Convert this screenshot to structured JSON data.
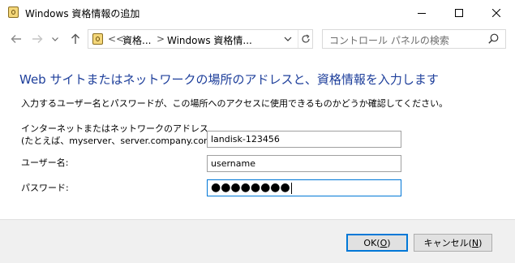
{
  "window": {
    "title": "Windows 資格情報の追加"
  },
  "address_bar": {
    "prefix": "<<",
    "crumb1": "資格...",
    "separator": ">",
    "crumb2": "Windows 資格情..."
  },
  "search": {
    "placeholder": "コントロール パネルの検索"
  },
  "main": {
    "heading": "Web サイトまたはネットワークの場所のアドレスと、資格情報を入力します",
    "description": "入力するユーザー名とパスワードが、この場所へのアクセスに使用できるものかどうか確認してください。"
  },
  "form": {
    "address_label_line1": "インターネットまたはネットワークのアドレス",
    "address_label_line2": "(たとえば、myserver、server.company.com):",
    "address_value": "landisk-123456",
    "username_label": "ユーザー名:",
    "username_value": "username",
    "password_label": "パスワード:",
    "password_value": "●●●●●●●●"
  },
  "buttons": {
    "ok_text": "OK(",
    "ok_key": "O",
    "ok_close": ")",
    "cancel_text": "キャンセル(",
    "cancel_key": "N",
    "cancel_close": ")"
  },
  "colors": {
    "heading": "#1e3f9b",
    "focus_border": "#0078d7",
    "footer_bg": "#f0f0f0"
  },
  "icons": [
    "credential-manager-icon",
    "minimize-icon",
    "maximize-icon",
    "close-icon",
    "back-arrow-icon",
    "forward-arrow-icon",
    "history-dropdown-icon",
    "up-arrow-icon",
    "chevron-down-icon",
    "refresh-icon",
    "search-icon"
  ]
}
